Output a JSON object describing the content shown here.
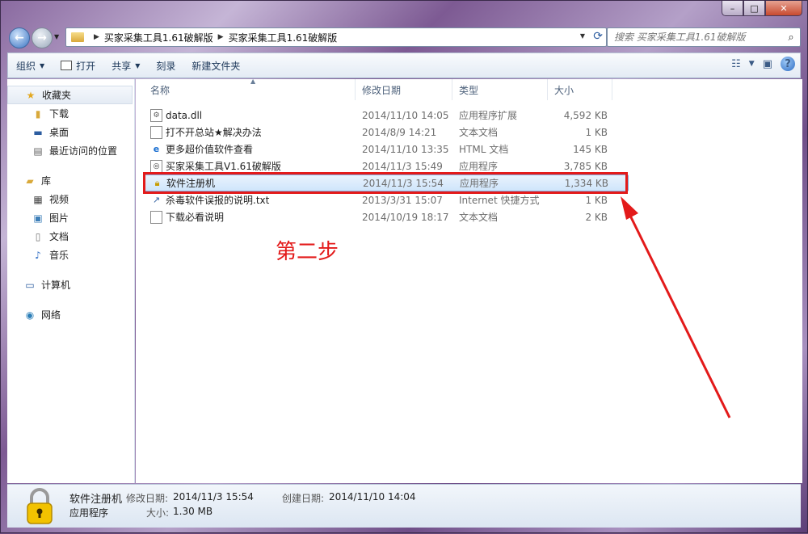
{
  "window": {
    "minimize_glyph": "–",
    "maximize_glyph": "□",
    "close_glyph": "✕"
  },
  "address": {
    "crumbs": [
      "买家采集工具1.61破解版",
      "买家采集工具1.61破解版"
    ],
    "search_placeholder": "搜索 买家采集工具1.61破解版"
  },
  "toolbar": {
    "organize": "组织",
    "open": "打开",
    "share": "共享",
    "burn": "刻录",
    "new_folder": "新建文件夹"
  },
  "sidebar": {
    "favorites": "收藏夹",
    "fav_items": [
      "下载",
      "桌面",
      "最近访问的位置"
    ],
    "libraries": "库",
    "lib_items": [
      "视频",
      "图片",
      "文档",
      "音乐"
    ],
    "computer": "计算机",
    "network": "网络"
  },
  "columns": {
    "name": "名称",
    "modified": "修改日期",
    "type": "类型",
    "size": "大小"
  },
  "files": [
    {
      "name": "data.dll",
      "modified": "2014/11/10 14:05",
      "type": "应用程序扩展",
      "size": "4,592 KB",
      "icon": "dll-icon"
    },
    {
      "name": "打不开总站★解决办法",
      "modified": "2014/8/9 14:21",
      "type": "文本文档",
      "size": "1 KB",
      "icon": "text-file-icon"
    },
    {
      "name": "更多超价值软件查看",
      "modified": "2014/11/10 13:35",
      "type": "HTML 文档",
      "size": "145 KB",
      "icon": "ie-icon"
    },
    {
      "name": "买家采集工具V1.61破解版",
      "modified": "2014/11/3 15:49",
      "type": "应用程序",
      "size": "3,785 KB",
      "icon": "app-icon"
    },
    {
      "name": "软件注册机",
      "modified": "2014/11/3 15:54",
      "type": "应用程序",
      "size": "1,334 KB",
      "icon": "lock-icon"
    },
    {
      "name": "杀毒软件误报的说明.txt",
      "modified": "2013/3/31 15:07",
      "type": "Internet 快捷方式",
      "size": "1 KB",
      "icon": "shortcut-icon"
    },
    {
      "name": "下载必看说明",
      "modified": "2014/10/19 18:17",
      "type": "文本文档",
      "size": "2 KB",
      "icon": "text-file-icon"
    }
  ],
  "annotation": {
    "step_label": "第二步",
    "color": "#e31a1a"
  },
  "details": {
    "name": "软件注册机",
    "kind": "应用程序",
    "modified_label": "修改日期:",
    "modified_value": "2014/11/3 15:54",
    "created_label": "创建日期:",
    "created_value": "2014/11/10 14:04",
    "size_label": "大小:",
    "size_value": "1.30 MB"
  }
}
